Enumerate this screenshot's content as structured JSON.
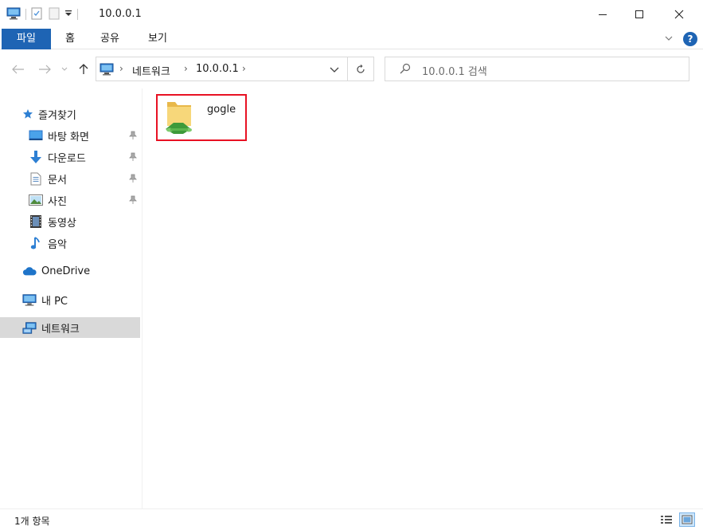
{
  "window": {
    "title": "10.0.0.1",
    "minimize_symbol": "—",
    "maximize_symbol": "☐",
    "close_symbol": "✕"
  },
  "ribbon": {
    "tabs": [
      {
        "label": "파일",
        "active": true
      },
      {
        "label": "홈"
      },
      {
        "label": "공유"
      },
      {
        "label": "보기"
      }
    ],
    "help_symbol": "?"
  },
  "address_bar": {
    "breadcrumb": [
      "네트워크",
      "10.0.0.1"
    ]
  },
  "search": {
    "placeholder": "10.0.0.1 검색"
  },
  "sidebar": {
    "quick_access": {
      "label": "즐겨찾기",
      "items": [
        {
          "label": "바탕 화면",
          "icon": "desktop-icon",
          "pinned": true
        },
        {
          "label": "다운로드",
          "icon": "download-icon",
          "pinned": true
        },
        {
          "label": "문서",
          "icon": "document-icon",
          "pinned": true
        },
        {
          "label": "사진",
          "icon": "pictures-icon",
          "pinned": true
        },
        {
          "label": "동영상",
          "icon": "video-icon"
        },
        {
          "label": "음악",
          "icon": "music-icon"
        }
      ]
    },
    "onedrive": {
      "label": "OneDrive"
    },
    "this_pc": {
      "label": "내 PC"
    },
    "network": {
      "label": "네트워크",
      "selected": true
    }
  },
  "content": {
    "items": [
      {
        "name": "gogle",
        "type": "shared-folder",
        "highlighted": true
      }
    ]
  },
  "status_bar": {
    "item_count": "1개 항목"
  },
  "colors": {
    "accent": "#1e64b4",
    "highlight_border": "#e81123",
    "selected_nav": "#d9d9d9"
  }
}
